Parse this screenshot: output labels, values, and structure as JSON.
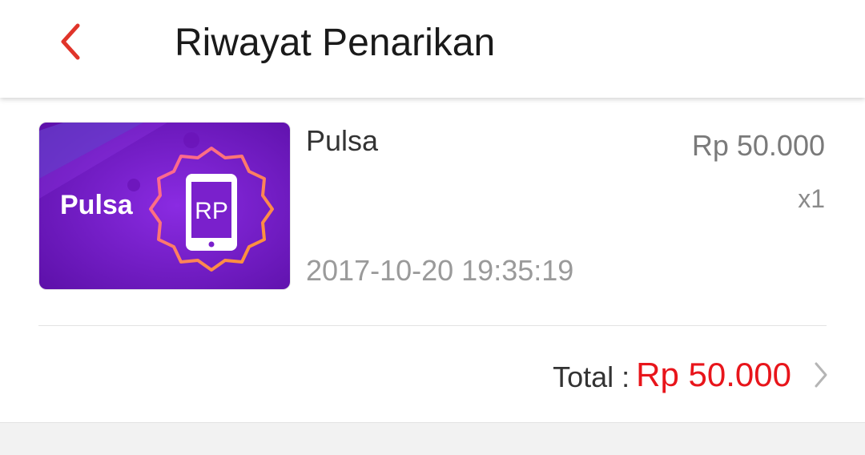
{
  "header": {
    "title": "Riwayat Penarikan",
    "back_icon": "chevron-left-icon"
  },
  "order": {
    "thumbnail": {
      "label": "Pulsa",
      "badge_text": "RP",
      "colors": {
        "bg_start": "#7b1fd1",
        "bg_end": "#5c10a8",
        "accent": "#ff8a3d"
      }
    },
    "product_name": "Pulsa",
    "price": "Rp 50.000",
    "quantity": "x1",
    "datetime": "2017-10-20 19:35:19",
    "total_label": "Total :",
    "total_value": "Rp 50.000",
    "detail_icon": "chevron-right-icon"
  },
  "colors": {
    "accent_red": "#e8151b",
    "back_red": "#e0342a"
  }
}
